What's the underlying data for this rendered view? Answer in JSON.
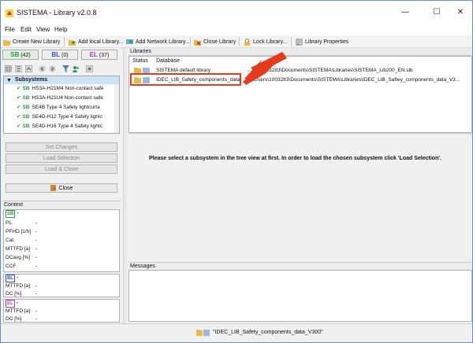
{
  "window": {
    "title": "SISTEMA - Library v2.0.8",
    "controls": {
      "minimize": "—",
      "maximize": "☐",
      "close": "✕"
    }
  },
  "menu": [
    "File",
    "Edit",
    "View",
    "Help"
  ],
  "toolbar": {
    "create": "Create New Library",
    "add_local": "Add local Library...",
    "add_network": "Add Network Library...",
    "close_library": "Close Library",
    "lock": "Lock Library...",
    "properties": "Library Properties"
  },
  "left": {
    "tabs": [
      {
        "code": "SB",
        "count": "(42)",
        "color": "#2e9a3a"
      },
      {
        "code": "BL",
        "count": "(0)",
        "color": "#2b52c4"
      },
      {
        "code": "EL",
        "count": "(37)",
        "color": "#b13bb8"
      }
    ],
    "tree": {
      "header": "Subsystems",
      "items": [
        {
          "tag": "SB",
          "label": "HS3A-H21M4 Non-contact safe"
        },
        {
          "tag": "SB",
          "label": "HS3A-H21U4 Non-contact safe"
        },
        {
          "tag": "SB",
          "label": "SE4B Type 4 Safety lightcurta"
        },
        {
          "tag": "SB",
          "label": "SE4D-H12 Type 4 Safety lightc"
        },
        {
          "tag": "SB",
          "label": "SE4D-H16 Type 4 Safety lightc"
        }
      ]
    },
    "buttons": {
      "set_changes": "Set Changes",
      "load_selection": "Load Selection",
      "load_close": "Load & Close",
      "close": "Close"
    },
    "context": {
      "header": "Context",
      "sb": {
        "tag": "SB",
        "value": "-",
        "rows": [
          {
            "label": "PL",
            "value": "-"
          },
          {
            "label": "PFHD [1/h]",
            "value": "-"
          },
          {
            "label": "Cat.",
            "value": "-"
          },
          {
            "label": "MTTFD [a]",
            "value": "-"
          },
          {
            "label": "DCavg [%]",
            "value": "-"
          },
          {
            "label": "CCF",
            "value": "-"
          }
        ]
      },
      "bl": {
        "tag": "BL",
        "value": "-",
        "rows": [
          {
            "label": "MTTFD [a]",
            "value": "-"
          },
          {
            "label": "DC [%]",
            "value": "-"
          }
        ]
      },
      "el": {
        "tag": "EL",
        "value": "-",
        "rows": [
          {
            "label": "MTTFD [a]",
            "value": "-"
          },
          {
            "label": "DC [%]",
            "value": "-"
          }
        ]
      }
    }
  },
  "libraries": {
    "header": "Libraries",
    "col_status": "Status",
    "col_database": "Database",
    "rows": [
      {
        "name": "SISTEMA default library",
        "path": "...ers\\1003283\\Documents\\SISTEMA\\Libraries\\SISTEMA_Lib200_EN.slb"
      },
      {
        "name": "IDEC_LIB_Safety_components_data",
        "path": "C:\\Users\\1003283\\Documents\\SISTEMA\\Libraries\\IDEC_LIB_Saftey_components_data_V3..."
      }
    ]
  },
  "center_message": "Please select a subsystem in the tree view at first. In order to load the chosen subsystem click 'Load Selection'.",
  "messages_header": "Messages",
  "status": "\"IDEC_LIB_Safety_components_data_V300\"",
  "colors": {
    "accent_red": "#e53a1e",
    "sb_green": "#2e9a3a",
    "bl_blue": "#2b52c4",
    "el_purple": "#b13bb8"
  }
}
